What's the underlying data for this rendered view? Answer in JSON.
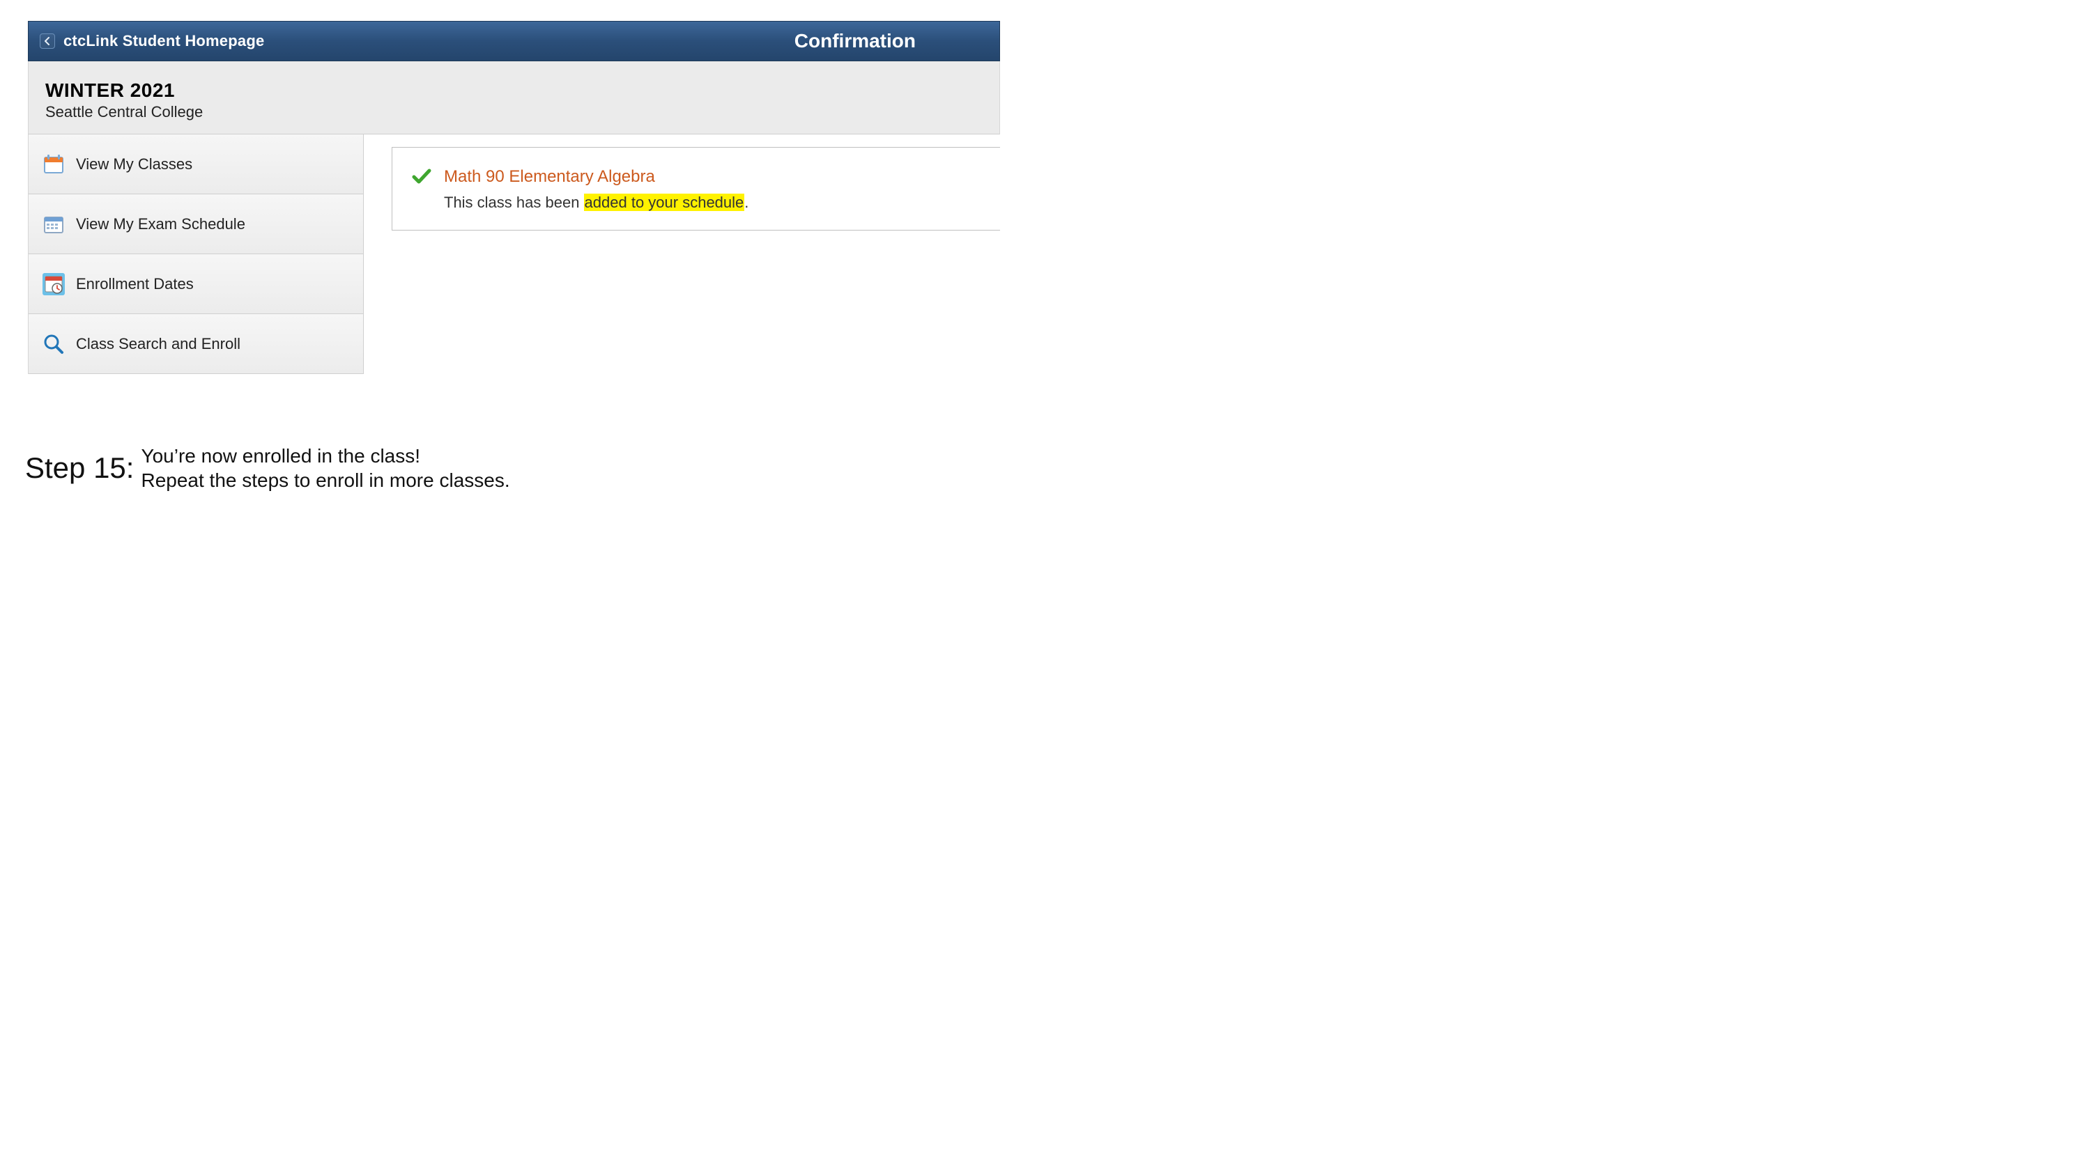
{
  "header": {
    "breadcrumb": "ctcLink Student Homepage",
    "page_title": "Confirmation"
  },
  "term": {
    "title": "WINTER 2021",
    "college": "Seattle Central College"
  },
  "sidebar": {
    "items": [
      {
        "label": "View My Classes"
      },
      {
        "label": "View My Exam Schedule"
      },
      {
        "label": "Enrollment Dates"
      },
      {
        "label": "Class Search and Enroll"
      }
    ]
  },
  "confirmation": {
    "class_name": "Math 90  Elementary Algebra",
    "msg_prefix": "This class has been ",
    "msg_highlight": "added to your schedule",
    "msg_suffix": "."
  },
  "step": {
    "label": "Step 15:",
    "line1": "You’re now enrolled in the class!",
    "line2": "Repeat the steps to enroll in more classes."
  }
}
